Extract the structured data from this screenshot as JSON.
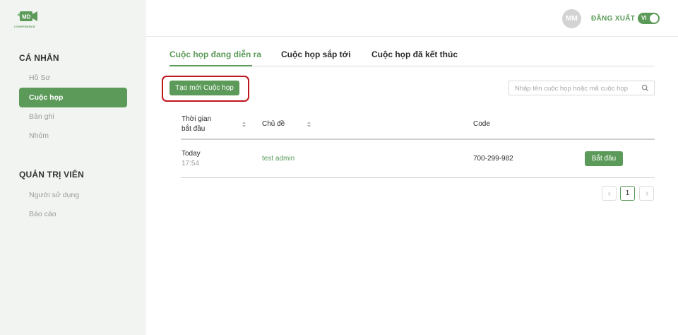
{
  "brand": {
    "logo_text": "MD",
    "logo_subtext": "CONFERENCE",
    "color": "#5b9a58"
  },
  "header": {
    "avatar_initials": "MM",
    "logout_label": "ĐĂNG XUẤT",
    "language_toggle": {
      "label": "VI",
      "on": true
    }
  },
  "sidebar": {
    "sections": [
      {
        "title": "CÁ NHÂN",
        "items": [
          {
            "label": "Hồ Sơ",
            "active": false
          },
          {
            "label": "Cuộc họp",
            "active": true
          },
          {
            "label": "Bản ghi",
            "active": false
          },
          {
            "label": "Nhóm",
            "active": false
          }
        ]
      },
      {
        "title": "QUẢN TRỊ VIÊN",
        "items": [
          {
            "label": "Người sử dụng",
            "active": false
          },
          {
            "label": "Báo cáo",
            "active": false
          }
        ]
      }
    ]
  },
  "tabs": [
    {
      "label": "Cuộc họp đang diễn ra",
      "active": true
    },
    {
      "label": "Cuộc họp sắp tới",
      "active": false
    },
    {
      "label": "Cuộc họp đã kết thúc",
      "active": false
    }
  ],
  "toolbar": {
    "create_label": "Tạo mới Cuộc họp",
    "search_placeholder": "Nhập tên cuộc họp hoặc mã cuộc họp",
    "search_value": ""
  },
  "table": {
    "columns": [
      "Thời gian\nbắt đầu",
      "Chủ đề",
      "Code"
    ],
    "columns_lines": [
      [
        "Thời gian",
        "bắt đầu"
      ],
      [
        "Chủ đề"
      ],
      [
        "Code"
      ]
    ],
    "rows": [
      {
        "start_day": "Today",
        "start_time": "17:54",
        "topic": "test admin",
        "code": "700-299-982",
        "action_label": "Bắt đầu"
      }
    ]
  },
  "pagination": {
    "prev_icon": "chevron-left-icon",
    "next_icon": "chevron-right-icon",
    "current_page": "1"
  }
}
